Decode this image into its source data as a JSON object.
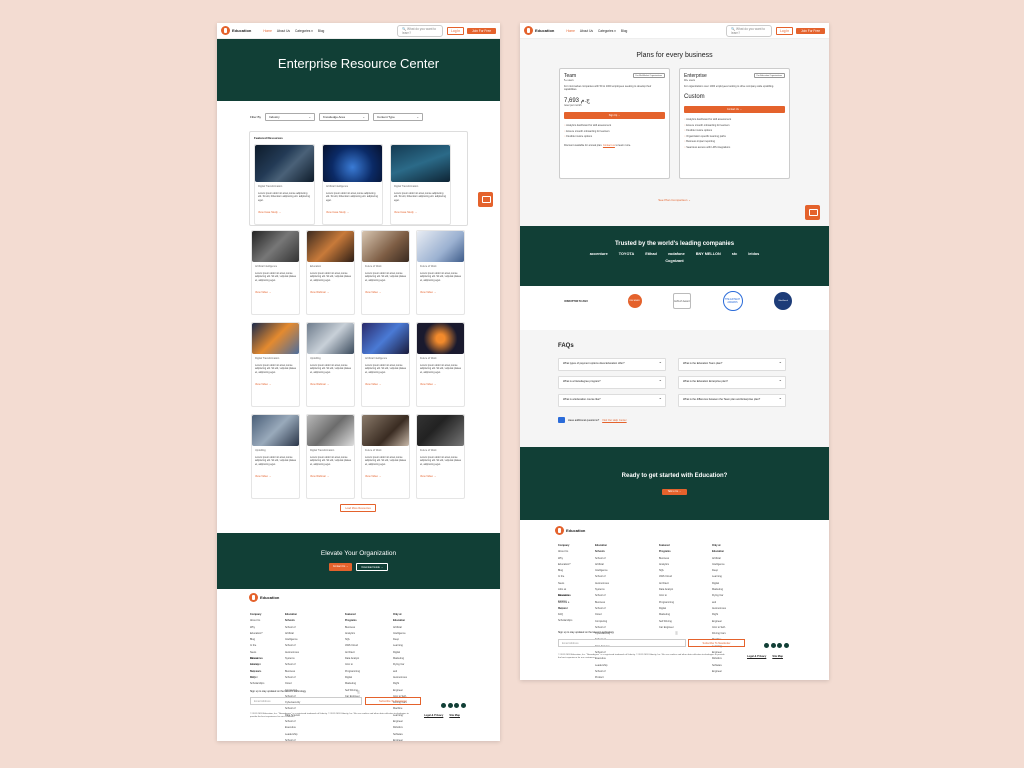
{
  "brand": {
    "name": "Education"
  },
  "colors": {
    "accent": "#e4622c",
    "dark_green": "#113f36",
    "background": "#f3dcd2"
  },
  "left_page": {
    "nav": {
      "links": [
        "Home",
        "About Us",
        "Categories ▾",
        "Blog"
      ],
      "search_placeholder": "What do you want to learn?",
      "login": "Log In",
      "join": "Join For Free"
    },
    "hero_title": "Enterprise Resource Center",
    "filters": {
      "label": "Filter By",
      "selects": [
        "Industry",
        "Knowledge Area",
        "Content Type"
      ]
    },
    "featured": {
      "heading": "Featured Resources",
      "cards": [
        {
          "tag": "Digital Transformation",
          "text": "Lorem ipsum dolor sit amet,conse adipiscing elit. Sit elit, bibendum adipiscing elit. adipiscing eget.",
          "link": "View Case Study →",
          "img": "img-a"
        },
        {
          "tag": "Artificial Intelligence",
          "text": "Lorem ipsum dolor sit amet,conse adipiscing elit. Sit elit, bibendum adipiscing elit. adipiscing eget.",
          "link": "View Case Study →",
          "img": "img-b"
        },
        {
          "tag": "Digital Transformation",
          "text": "Lorem ipsum dolor sit amet,conse adipiscing elit. Sit elit, bibendum adipiscing elit. adipiscing eget.",
          "link": "View Case Study →",
          "img": "img-c"
        }
      ]
    },
    "grid": [
      [
        {
          "tag": "Artificial Intelligence",
          "text": "Lorem ipsum dolor sit amet,conse adipiscing elit. Sit elit, vulputat platea et, adipiscing eget.",
          "link": "View Video →",
          "img": "img-d"
        },
        {
          "tag": "Education",
          "text": "Lorem ipsum dolor sit amet,conse adipiscing elit. Sit elit, vulputat platea et, adipiscing eget.",
          "link": "View Webinar →",
          "img": "img-e"
        },
        {
          "tag": "Future of Work",
          "text": "Lorem ipsum dolor sit amet,conse adipiscing elit. Sit elit, vulputat platea et, adipiscing eget.",
          "link": "View Video →",
          "img": "img-f"
        },
        {
          "tag": "Future of Work",
          "text": "Lorem ipsum dolor sit amet,conse adipiscing elit. Sit elit, vulputat platea et, adipiscing eget.",
          "link": "View Video →",
          "img": "img-g"
        }
      ],
      [
        {
          "tag": "Digital Transformation",
          "text": "Lorem ipsum dolor sit amet,conse adipiscing elit. Sit elit, vulputat platea et, adipiscing eget.",
          "link": "View Video →",
          "img": "img-h"
        },
        {
          "tag": "Upskilling",
          "text": "Lorem ipsum dolor sit amet,conse adipiscing elit. Sit elit, vulputat platea et, adipiscing eget.",
          "link": "View Webinar →",
          "img": "img-i"
        },
        {
          "tag": "Artificial Intelligence",
          "text": "Lorem ipsum dolor sit amet,conse adipiscing elit. Sit elit, vulputat platea et, adipiscing eget.",
          "link": "View Video →",
          "img": "img-j"
        },
        {
          "tag": "Future of Work",
          "text": "Lorem ipsum dolor sit amet,conse adipiscing elit. Sit elit, vulputat platea et, adipiscing eget.",
          "link": "View Video →",
          "img": "img-k"
        }
      ],
      [
        {
          "tag": "Upskilling",
          "text": "Lorem ipsum dolor sit amet,conse adipiscing elit. Sit elit, vulputat platea et, adipiscing eget.",
          "link": "View Video →",
          "img": "img-l"
        },
        {
          "tag": "Digital Transformation",
          "text": "Lorem ipsum dolor sit amet,conse adipiscing elit. Sit elit, vulputat platea et, adipiscing eget.",
          "link": "View Webinar →",
          "img": "img-m"
        },
        {
          "tag": "Future of Work",
          "text": "Lorem ipsum dolor sit amet,conse adipiscing elit. Sit elit, vulputat platea et, adipiscing eget.",
          "link": "View Video →",
          "img": "img-n"
        },
        {
          "tag": "Future of Work",
          "text": "Lorem ipsum dolor sit amet,conse adipiscing elit. Sit elit, vulputat platea et, adipiscing eget.",
          "link": "View Video →",
          "img": "img-o"
        }
      ]
    ],
    "load_more": "Load More Resources",
    "elevate": {
      "title": "Elevate Your Organization",
      "btn1": "Contact Us →",
      "btn2": "Download Guide →"
    }
  },
  "footer": {
    "company": {
      "heading": "Company",
      "items": [
        "About Us",
        "Why Education?",
        "Blog",
        "In the News",
        "Jobs at Education",
        "Become a Mentor"
      ]
    },
    "resources": {
      "heading": "Resources",
      "items": [
        "Catalog",
        "Help and FAQ",
        "Scholarships"
      ]
    },
    "schools": {
      "heading": "Education Schools",
      "items": [
        "School of Artificial Intelligence",
        "School of Autonomous Systems",
        "School of Business",
        "School of Cloud Computing",
        "School of Cybersecurity",
        "School of Data Science",
        "School of Executive Leadership",
        "School of Product Management",
        "School of Programming"
      ]
    },
    "programs": {
      "heading": "Featured Programs",
      "items": [
        "Business Analytics",
        "SQL",
        "AWS Cloud Architect",
        "Data Analyst",
        "Intro to Programming",
        "Digital Marketing",
        "Self Driving Car Engineer"
      ]
    },
    "only": {
      "heading": "Only at Education",
      "items": [
        "Artificial Intelligence",
        "Deep Learning",
        "Digital Marketing",
        "Flying Car and Autonomous Flight Engineer",
        "Intro to Self-Driving Cars",
        "Machine Learning Engineer",
        "Robotics Software Engineer"
      ]
    },
    "newsletter_label": "Sign up to stay updated on the latest in technology",
    "email_placeholder": "Email Address",
    "subscribe": "Subscribe To Newsletter",
    "copyright": "© 2011-2024 Education, Inc. \"Nanodegree\" is a registered trademark of Udacity. © 2011-2024 Udacity, Inc. We use cookies and other data collection technologies to provide the best experience for our customers.",
    "legal": "Legal & Privacy",
    "sitemap": "Site Map"
  },
  "right_page": {
    "nav": {
      "links": [
        "Home",
        "About Us",
        "Categories ▾",
        "Blog"
      ],
      "search_placeholder": "What do you want to learn?",
      "login": "Log In",
      "join": "Join For Free"
    },
    "plans_title": "Plans for every business",
    "team": {
      "name": "Team",
      "badge": "For Mid-Market Organizations",
      "seats": "5+ users",
      "desc": "For mid-market companies with 50 to 1000 employees seeking to develop their capabilities.",
      "price": "7,693 ج.م",
      "per": "/user per month",
      "btn": "Sign Up →",
      "features": [
        "Analytics dashboard for skill assessment",
        "Ensure smooth onboarding for learners",
        "Flexible invoice options"
      ],
      "note_prefix": "Discount available for annual plan.",
      "note_link": "Contact us",
      "note_suffix": "to learn more."
    },
    "enterprise": {
      "name": "Enterprise",
      "badge": "For Education Organizations",
      "seats": "40+ users",
      "desc": "For organizations over 1000 employees looking to drive company-wide upskilling.",
      "price": "Custom",
      "btn": "Contact Us →",
      "features": [
        "Analytics dashboard for skill assessment",
        "Ensure smooth onboarding for learners",
        "Flexible invoice options",
        "Organization specific learning paths",
        "Business impact reporting",
        "Seamless access with LMS integrations"
      ]
    },
    "see_comparison": "See Plan Comparison ⌄",
    "trusted_title": "Trusted by the world's leading companies",
    "brands": [
      "accenture",
      "TOYOTA",
      "Etihad",
      "vodafone",
      "BNY MELLON",
      "stc",
      "leidos",
      "Cognizant"
    ],
    "awards": [
      "DISRUPTOR 50 2023",
      "CNBC AWARD",
      "EdTech Award",
      "THE EDTECH AWARDS",
      "Global Award"
    ],
    "faq_title": "FAQs",
    "faqs": [
      "What types of payment options does Education offer?",
      "What is the Education Team plan?",
      "What is a Nanodegree program?",
      "What is the Education Enterprise plan?",
      "What is a Education course like?",
      "What is the difference between the Team plan and Enterprise plan?"
    ],
    "help_prefix": "Have additional questions?",
    "help_link": "Visit Our Help Center",
    "ready_title": "Ready to get started with Education?",
    "ready_btn": "Talk to Us →"
  }
}
